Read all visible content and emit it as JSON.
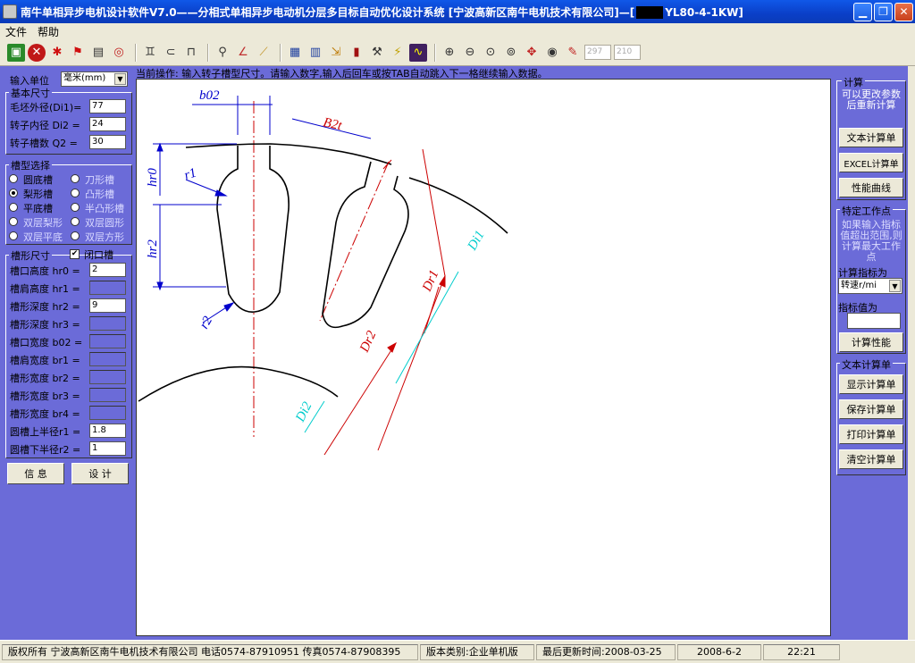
{
  "window": {
    "title": "南牛单相异步电机设计软件V7.0——分相式单相异步电动机分层多目标自动优化设计系统  [宁波高新区南牛电机技术有限公司]—[",
    "title_suffix": "YL80-4-1KW]"
  },
  "menu": [
    "文件",
    "帮助"
  ],
  "toolbar": {
    "field1": "297",
    "field2": "210"
  },
  "hint": "当前操作: 输入转子槽型尺寸。请输入数字,输入后回车或按TAB自动跳入下一格继续输入数据。",
  "left": {
    "unit_label": "输入单位",
    "unit_value": "毫米(mm)",
    "basic_title": "基本尺寸",
    "basic": [
      {
        "label": "毛坯外径(Di1)=",
        "value": "77"
      },
      {
        "label": "转子内径 Di2 =",
        "value": "24"
      },
      {
        "label": "转子槽数  Q2 =",
        "value": "30"
      }
    ],
    "slot_type_title": "槽型选择",
    "slot_types": [
      "圆底槽",
      "刀形槽",
      "梨形槽",
      "凸形槽",
      "平底槽",
      "半凸形槽",
      "双层梨形",
      "双层圆形",
      "双层平底",
      "双层方形"
    ],
    "shape_title": "槽形尺寸",
    "closed_label": "闭口槽",
    "dims": [
      {
        "label": "槽口高度  hr0 =",
        "value": "2"
      },
      {
        "label": "槽肩高度  hr1 =",
        "value": ""
      },
      {
        "label": "槽形深度  hr2 =",
        "value": "9"
      },
      {
        "label": "槽形深度  hr3 =",
        "value": ""
      },
      {
        "label": "槽口宽度  b02 =",
        "value": ""
      },
      {
        "label": "槽肩宽度  br1 =",
        "value": ""
      },
      {
        "label": "槽形宽度  br2 =",
        "value": ""
      },
      {
        "label": "槽形宽度  br3 =",
        "value": ""
      },
      {
        "label": "槽形宽度  br4 =",
        "value": ""
      },
      {
        "label": "圆槽上半径r1 =",
        "value": "1.8"
      },
      {
        "label": "圆槽下半径r2 =",
        "value": "1"
      }
    ],
    "info_button": "信 息",
    "design_button": "设 计"
  },
  "drawing": {
    "labels": {
      "b02": "b02",
      "B2t": "B2t",
      "hr0": "hr0",
      "r1": "r1",
      "hr2": "hr2",
      "r2": "r2",
      "Dr1": "Dr1",
      "Dr2": "Dr2",
      "Di1": "Di1",
      "Di2": "Di2"
    },
    "colors": {
      "dim": "#0000cc",
      "axis": "#cc0000",
      "outline": "#000000",
      "diameter": "#00cccc"
    }
  },
  "right": {
    "calc_title": "计算",
    "calc_note": "可以更改参数后重新计算",
    "text_report_button": "文本计算单",
    "excel_button": "EXCEL计算单",
    "curve_button": "性能曲线",
    "point_title": "特定工作点",
    "point_note": "如果输入指标值超出范围,则计算最大工作点",
    "index_label": "计算指标为",
    "index_value": "转速r/mi",
    "value_label": "指标值为",
    "value_input": "",
    "perf_button": "计算性能",
    "report_title": "文本计算单",
    "show_button": "显示计算单",
    "save_button": "保存计算单",
    "print_button": "打印计算单",
    "clear_button": "清空计算单"
  },
  "status": {
    "copyright": "版权所有  宁波高新区南牛电机技术有限公司  电话0574-87910951  传真0574-87908395",
    "edition": "版本类别:企业单机版",
    "updated": "最后更新时间:2008-03-25",
    "date": "2008-6-2",
    "time": "22:21"
  }
}
